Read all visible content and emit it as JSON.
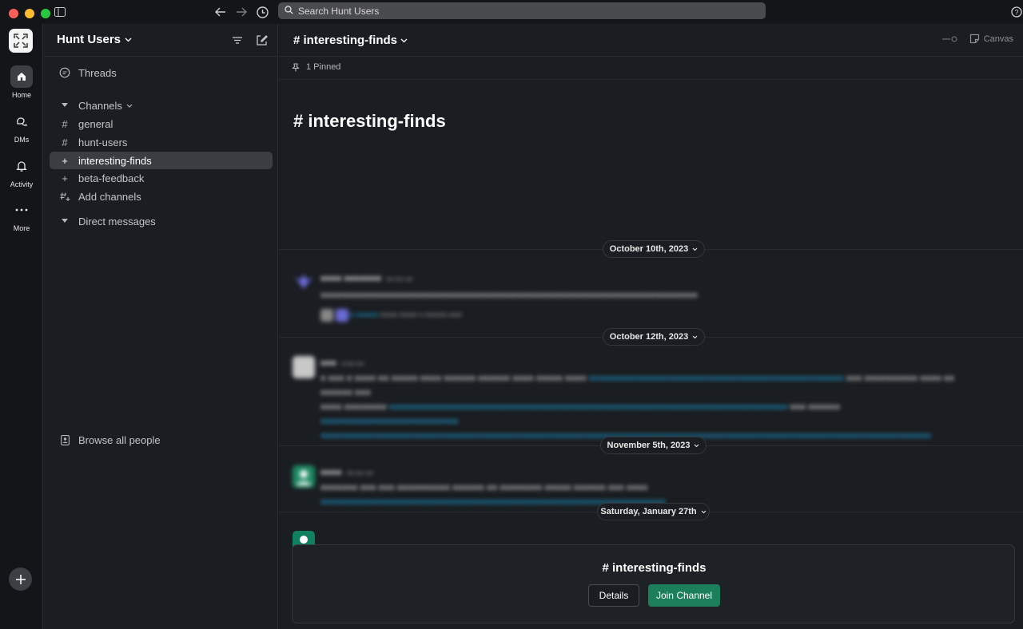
{
  "colors": {
    "accent_green": "#1b7f5b",
    "link_blue": "#1d9bd1",
    "traffic_red": "#ff5f57",
    "traffic_yellow": "#febc2e",
    "traffic_green": "#28c840"
  },
  "toolbar": {
    "search_placeholder": "Search Hunt Users",
    "back_icon": "arrow-left-icon",
    "forward_icon": "arrow-right-icon",
    "history_icon": "clock-icon",
    "help_icon": "help-icon"
  },
  "rail": {
    "items": [
      {
        "label": "Home",
        "icon": "home-icon",
        "active": true
      },
      {
        "label": "DMs",
        "icon": "chat-bubbles-icon",
        "active": false
      },
      {
        "label": "Activity",
        "icon": "bell-icon",
        "active": false
      },
      {
        "label": "More",
        "icon": "ellipsis-icon",
        "active": false
      }
    ]
  },
  "sidebar": {
    "workspace_name": "Hunt Users",
    "threads_label": "Threads",
    "channels_label": "Channels",
    "channels": [
      {
        "label": "general",
        "icon": "hash-icon",
        "active": false
      },
      {
        "label": "hunt-users",
        "icon": "hash-icon",
        "active": false
      },
      {
        "label": "interesting-finds",
        "icon": "plus-icon",
        "active": true
      },
      {
        "label": "beta-feedback",
        "icon": "plus-icon",
        "active": false
      }
    ],
    "add_channels_label": "Add channels",
    "direct_messages_label": "Direct messages",
    "browse_people_label": "Browse all people"
  },
  "channel": {
    "name": "# interesting-finds",
    "canvas_label": "Canvas",
    "pinned_label": "1 Pinned",
    "intro_title": "# interesting-finds"
  },
  "dates": [
    "October 10th, 2023",
    "October 12th, 2023",
    "November 5th, 2023",
    "Saturday, January 27th"
  ],
  "join_prompt": {
    "title": "# interesting-finds",
    "details_label": "Details",
    "join_label": "Join Channel"
  }
}
